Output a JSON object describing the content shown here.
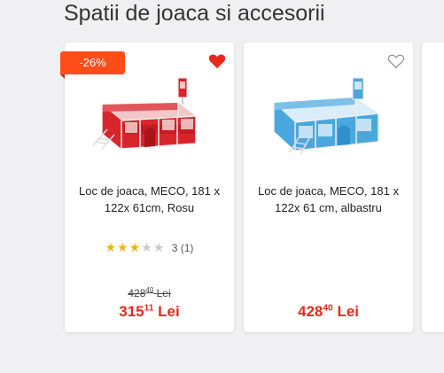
{
  "section": {
    "title": "Spatii de joaca si accesorii"
  },
  "colors": {
    "accent_red": "#e8281b",
    "badge_orange": "#ff4d1a",
    "star_gold": "#f2b21c",
    "product_red": "#d8252b",
    "product_blue": "#4aa7de"
  },
  "products": [
    {
      "discount": "-26%",
      "favorite": true,
      "favorite_icon": "heart-filled-icon",
      "name": "Loc de joaca, MECO, 181 x 122x 61cm, Rosu",
      "rating": {
        "stars_filled": 3,
        "stars_total": 5,
        "text": "3 (1)"
      },
      "old_price_main": "428",
      "old_price_decimals": "40",
      "old_price_currency": "Lei",
      "price_main": "315",
      "price_decimals": "11",
      "price_currency": "Lei"
    },
    {
      "favorite": false,
      "favorite_icon": "heart-outline-icon",
      "name": "Loc de joaca, MECO, 181 x 122x 61 cm,    albastru",
      "price_main": "428",
      "price_decimals": "40",
      "price_currency": "Lei"
    }
  ]
}
